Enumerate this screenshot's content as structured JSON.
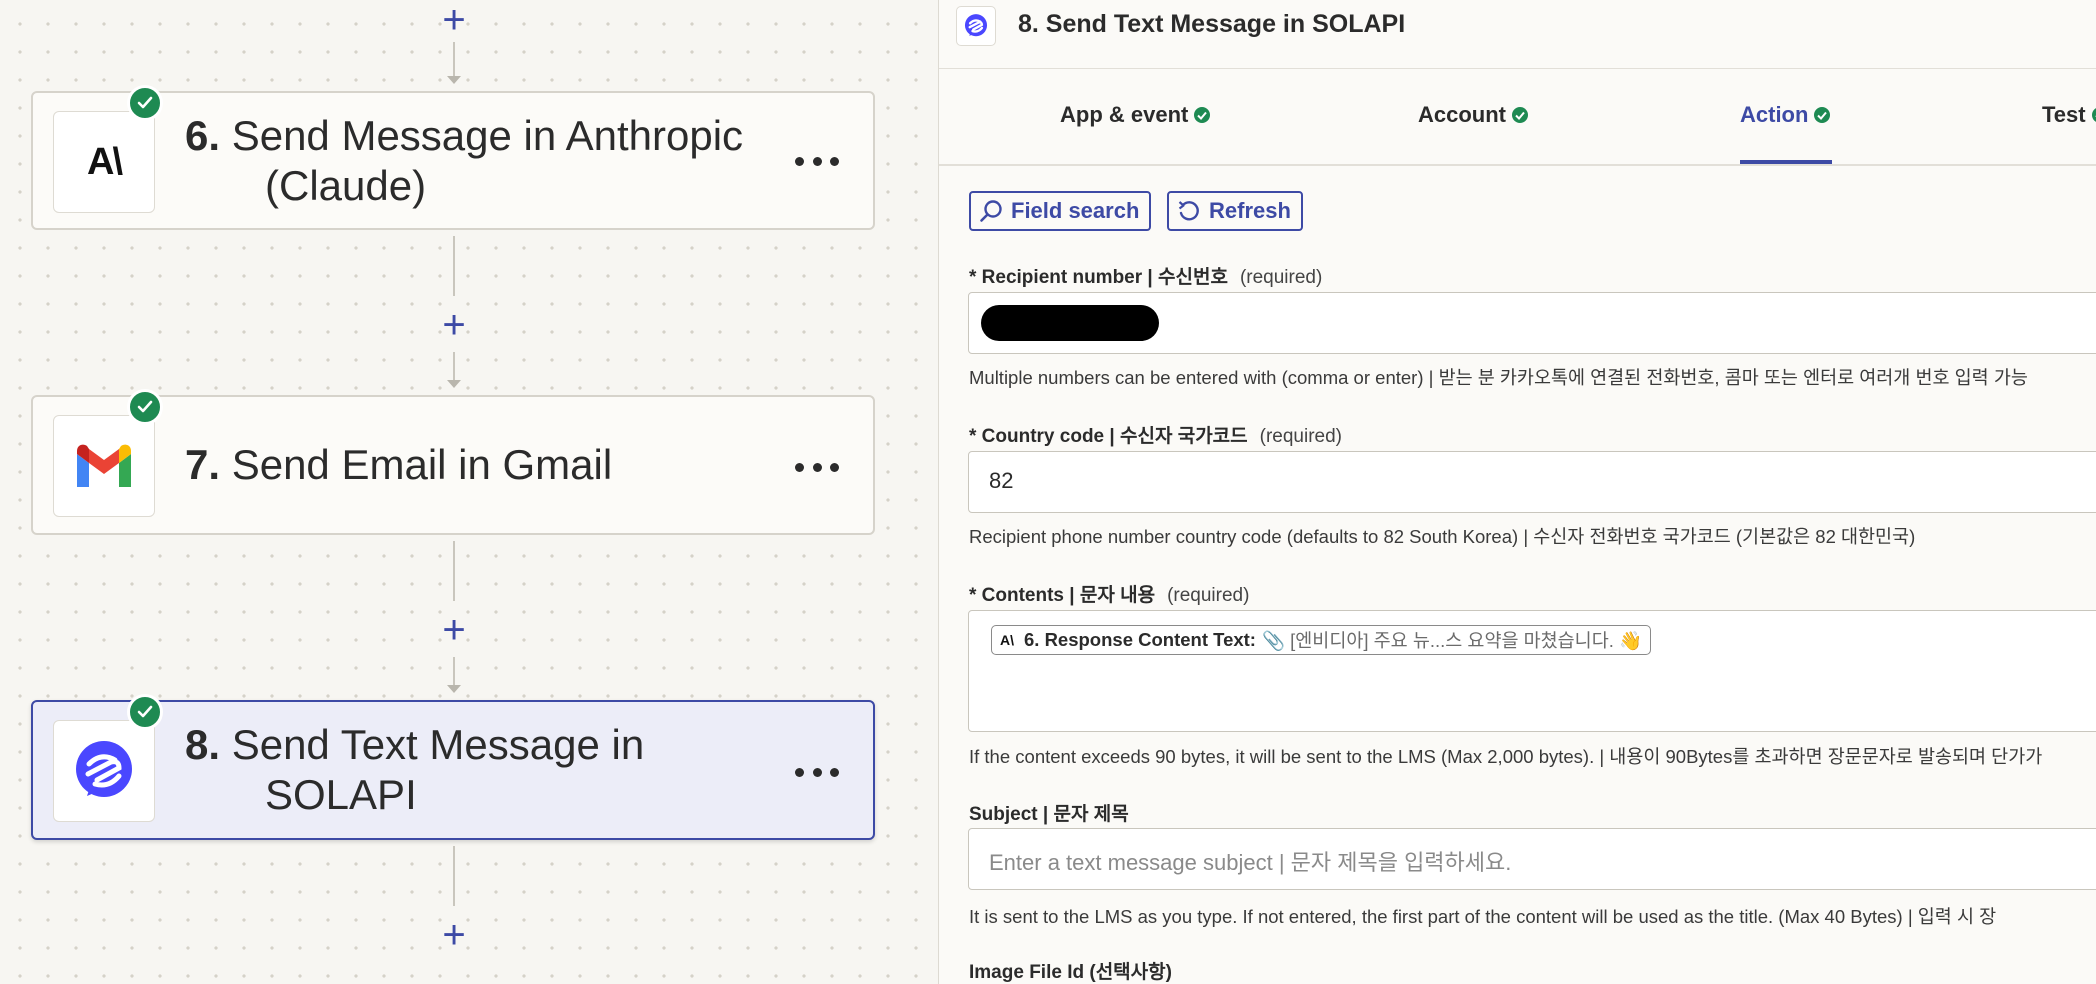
{
  "canvas": {
    "steps": [
      {
        "number": "6.",
        "title_line1": "Send Message in Anthropic",
        "title_line2": "(Claude)",
        "app": "Anthropic",
        "logo_text": "A\\",
        "icon": "anthropic-logo",
        "status": "complete"
      },
      {
        "number": "7.",
        "title_line1": "Send Email in Gmail",
        "title_line2": "",
        "app": "Gmail",
        "icon": "gmail-logo",
        "status": "complete"
      },
      {
        "number": "8.",
        "title_line1": "Send Text Message in",
        "title_line2": "SOLAPI",
        "app": "SOLAPI",
        "icon": "solapi-logo",
        "status": "complete",
        "selected": true
      }
    ],
    "add_step_glyph": "+"
  },
  "panel": {
    "title": "8. Send Text Message in SOLAPI",
    "tabs": [
      {
        "label": "App & event",
        "status": "complete"
      },
      {
        "label": "Account",
        "status": "complete"
      },
      {
        "label": "Action",
        "status": "complete",
        "active": true
      },
      {
        "label": "Test",
        "status": "complete"
      }
    ],
    "buttons": {
      "field_search": "Field search",
      "refresh": "Refresh"
    },
    "fields": {
      "recipient": {
        "label": "* Recipient number | 수신번호",
        "required": "(required)",
        "value_redacted": true,
        "help": "Multiple numbers can be entered with (comma or enter) | 받는 분 카카오톡에 연결된 전화번호, 콤마 또는 엔터로 여러개 번호 입력 가능"
      },
      "country_code": {
        "label": "* Country code | 수신자 국가코드",
        "required": "(required)",
        "value": "82",
        "help": "Recipient phone number country code (defaults to 82 South Korea) | 수신자 전화번호 국가코드 (기본값은 82 대한민국)"
      },
      "contents": {
        "label": "* Contents | 문자 내용",
        "required": "(required)",
        "pill_logo": "A\\",
        "pill_label": "6. Response Content Text:",
        "pill_value": "📎 [엔비디아] 주요 뉴...스 요약을 마쳤습니다. 👋",
        "help": "If the content exceeds 90 bytes, it will be sent to the LMS (Max 2,000 bytes). | 내용이 90Bytes를 초과하면 장문문자로 발송되며 단가가"
      },
      "subject": {
        "label": "Subject | 문자 제목",
        "placeholder": "Enter a text message subject | 문자 제목을 입력하세요.",
        "help": "It is sent to the LMS as you type. If not entered, the first part of the content will be used as the title. (Max 40 Bytes) | 입력 시 장"
      },
      "image_file": {
        "label": "Image File Id (선택사항)"
      }
    }
  },
  "colors": {
    "accent": "#3d4aa5",
    "success": "#1e8a52",
    "selected_bg": "#ecedf8"
  }
}
